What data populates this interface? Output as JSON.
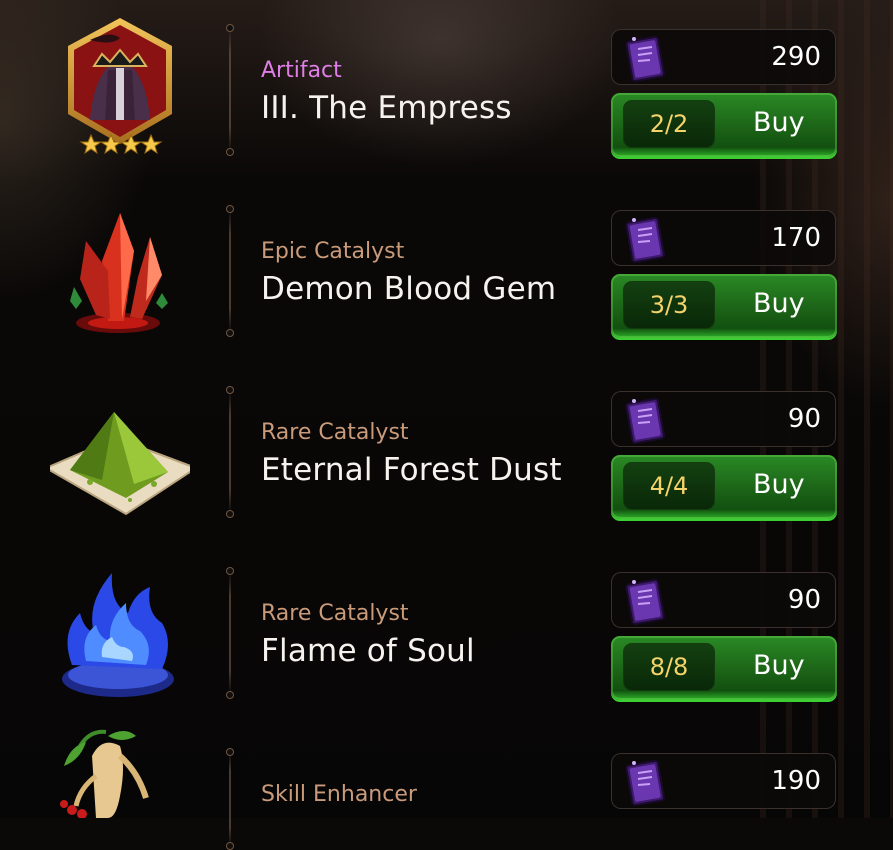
{
  "currency": {
    "icon": "purple-book-currency-icon"
  },
  "colors": {
    "artifact_category": "#e07ee8",
    "catalyst_category": "#c99b7a",
    "count_text": "#f4d36b",
    "buy_button": "#1f7a1a"
  },
  "items": [
    {
      "category": "Artifact",
      "name": "III. The Empress",
      "price": "290",
      "count": "2/2",
      "buy_label": "Buy",
      "icon": "empress-artifact-icon",
      "stars": 4
    },
    {
      "category": "Epic Catalyst",
      "name": "Demon Blood Gem",
      "price": "170",
      "count": "3/3",
      "buy_label": "Buy",
      "icon": "red-crystal-icon"
    },
    {
      "category": "Rare Catalyst",
      "name": "Eternal Forest Dust",
      "price": "90",
      "count": "4/4",
      "buy_label": "Buy",
      "icon": "green-dust-pile-icon"
    },
    {
      "category": "Rare Catalyst",
      "name": "Flame of Soul",
      "price": "90",
      "count": "8/8",
      "buy_label": "Buy",
      "icon": "blue-flame-icon"
    },
    {
      "category": "Skill Enhancer",
      "name": "",
      "price": "190",
      "icon": "ginseng-root-icon"
    }
  ]
}
